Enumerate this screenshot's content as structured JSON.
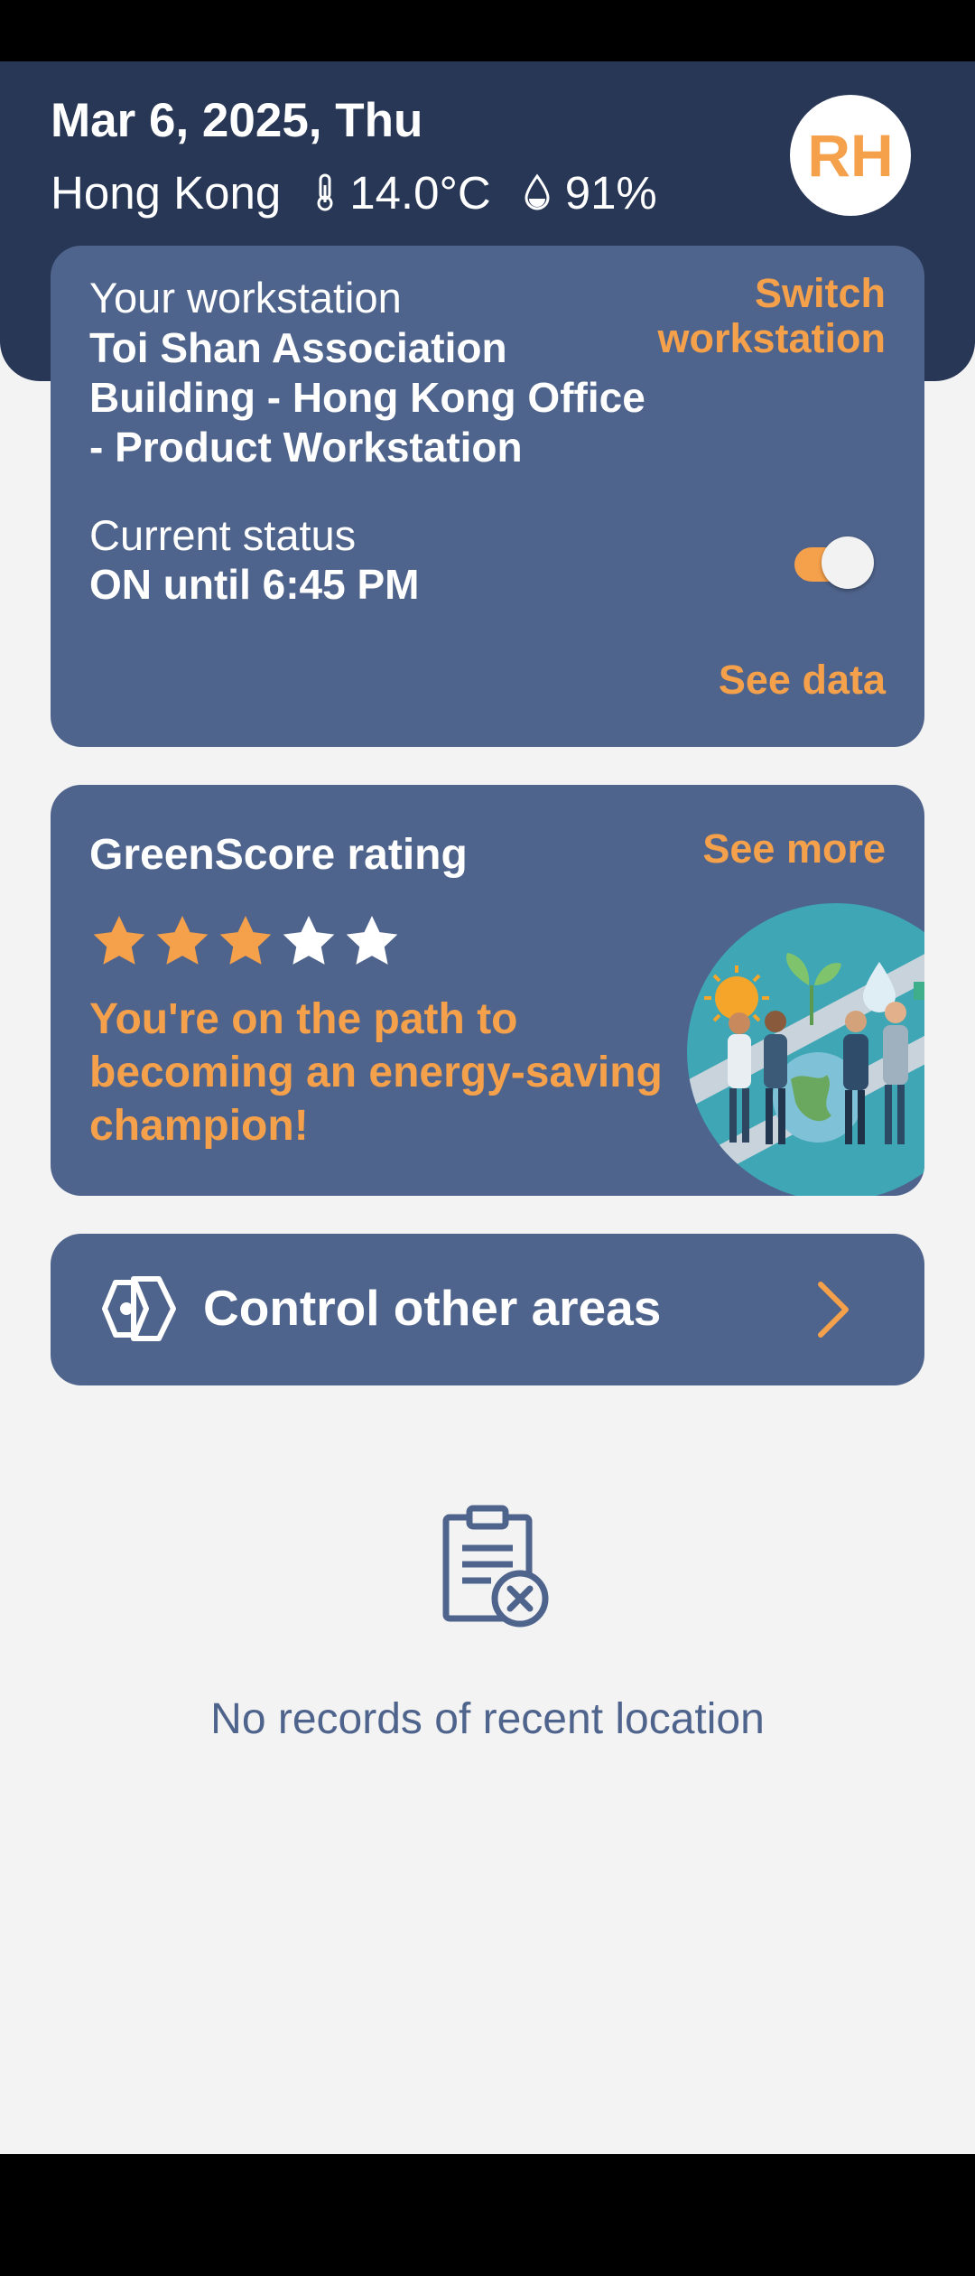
{
  "header": {
    "date": "Mar 6, 2025, Thu",
    "city": "Hong Kong",
    "temperature": "14.0°C",
    "humidity": "91%",
    "avatar_initials": "RH"
  },
  "workstation": {
    "label": "Your workstation",
    "name": "Toi Shan Association Building - Hong Kong Office - Product Workstation",
    "switch_label": "Switch workstation",
    "status_label": "Current status",
    "status_value": "ON until 6:45 PM",
    "toggle_on": true,
    "see_data_label": "See data"
  },
  "greenscore": {
    "title": "GreenScore rating",
    "see_more_label": "See more",
    "rating": 3,
    "max_rating": 5,
    "message": "You're on the path to becoming an energy-saving champion!"
  },
  "control": {
    "label": "Control other areas"
  },
  "empty_state": {
    "message": "No records of recent location"
  },
  "icons": {
    "temperature": "thermometer-icon",
    "humidity": "droplet-icon",
    "control": "hexagon-area-icon",
    "chevron": "chevron-right-icon",
    "empty": "clipboard-x-icon"
  },
  "colors": {
    "header_bg": "#283756",
    "card_bg": "#4f648c",
    "accent": "#f5a04a",
    "page_bg": "#f3f3f4"
  }
}
